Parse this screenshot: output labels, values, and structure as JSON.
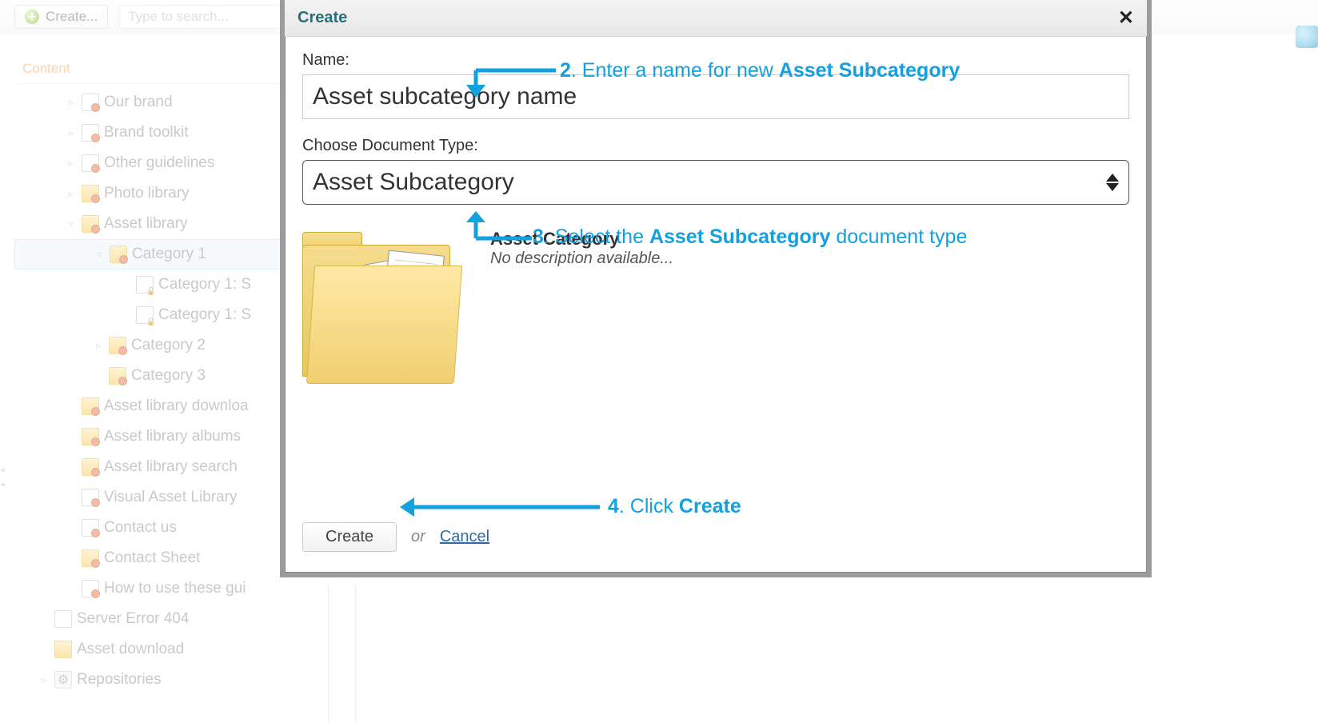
{
  "toolbar": {
    "create_label": "Create...",
    "search_placeholder": "Type to search..."
  },
  "side_panel": {
    "title": "Content",
    "tree": [
      {
        "indent": 1,
        "expander": "▹",
        "icon": "page-dot",
        "label": "Our brand"
      },
      {
        "indent": 1,
        "expander": "▹",
        "icon": "page-dot",
        "label": "Brand toolkit"
      },
      {
        "indent": 1,
        "expander": "▹",
        "icon": "page-dot",
        "label": "Other guidelines"
      },
      {
        "indent": 1,
        "expander": "▹",
        "icon": "folder-dot",
        "label": "Photo library"
      },
      {
        "indent": 1,
        "expander": "▿",
        "icon": "folder-dot",
        "label": "Asset library"
      },
      {
        "indent": 2,
        "expander": "▿",
        "icon": "folder-dot",
        "label": "Category 1",
        "selected": true
      },
      {
        "indent": 3,
        "expander": "",
        "icon": "pagelock",
        "label": "Category 1: S"
      },
      {
        "indent": 3,
        "expander": "",
        "icon": "pagelock",
        "label": "Category 1: S"
      },
      {
        "indent": 2,
        "expander": "▹",
        "icon": "folder-dot",
        "label": "Category 2"
      },
      {
        "indent": 2,
        "expander": "",
        "icon": "folder-dot",
        "label": "Category 3"
      },
      {
        "indent": 1,
        "expander": "",
        "icon": "folder-dot",
        "label": "Asset library downloa"
      },
      {
        "indent": 1,
        "expander": "",
        "icon": "folder-dot",
        "label": "Asset library albums"
      },
      {
        "indent": 1,
        "expander": "",
        "icon": "folder-dot",
        "label": "Asset library search"
      },
      {
        "indent": 1,
        "expander": "",
        "icon": "page-dot",
        "label": "Visual Asset Library"
      },
      {
        "indent": 1,
        "expander": "",
        "icon": "page-dot",
        "label": "Contact us"
      },
      {
        "indent": 1,
        "expander": "",
        "icon": "folder-dot",
        "label": "Contact Sheet"
      },
      {
        "indent": 1,
        "expander": "",
        "icon": "page-dot",
        "label": "How to use these gui"
      },
      {
        "indent": 0,
        "expander": "",
        "icon": "page",
        "label": "Server Error 404"
      },
      {
        "indent": 0,
        "expander": "",
        "icon": "folder",
        "label": "Asset download"
      },
      {
        "indent": 0,
        "expander": "▹",
        "icon": "gear",
        "label": "Repositories"
      }
    ]
  },
  "modal": {
    "title": "Create",
    "name_label": "Name:",
    "name_value": "Asset subcategory name",
    "doctype_label": "Choose Document Type:",
    "doctype_value": "Asset Subcategory",
    "preview_title": "Asset Category",
    "preview_desc": "No description available...",
    "create_button": "Create",
    "or_text": "or",
    "cancel_link": "Cancel"
  },
  "annotations": {
    "step2_prefix": "2",
    "step2_mid": ". Enter a name for new ",
    "step2_bold": "Asset Subcategory",
    "step3_prefix": "3",
    "step3_mid": ". Select the ",
    "step3_bold": "Asset Subcategory",
    "step3_suffix": " document type",
    "step4_prefix": "4",
    "step4_mid": ". Click ",
    "step4_bold": "Create"
  },
  "colors": {
    "annotation": "#12a0df",
    "panel_title": "#f6a14c",
    "modal_title": "#2c6e76"
  }
}
